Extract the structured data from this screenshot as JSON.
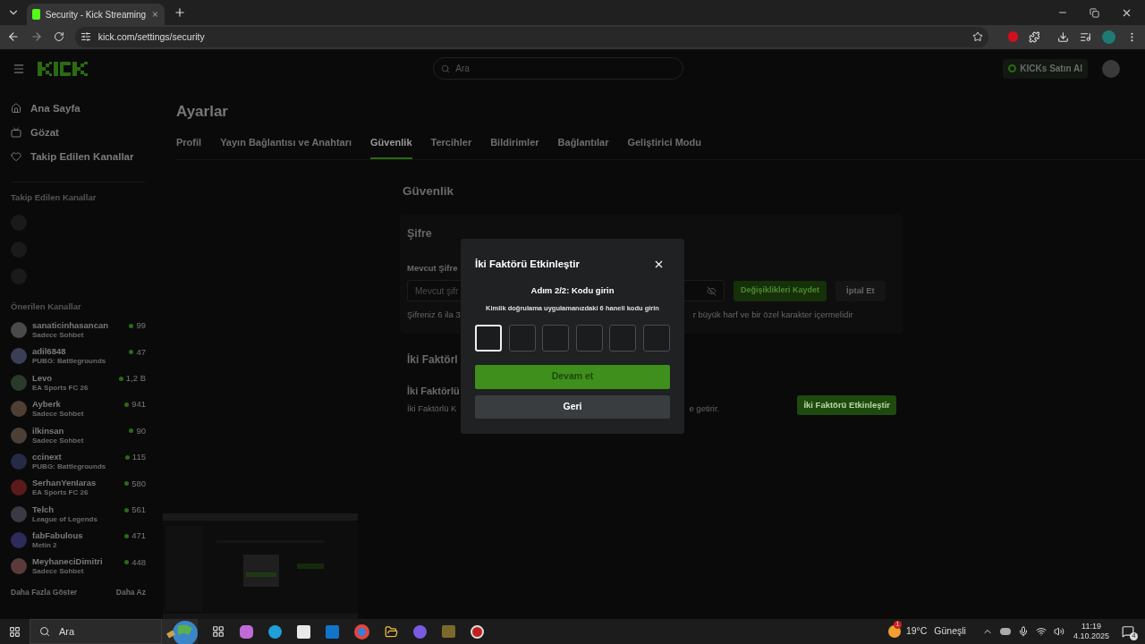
{
  "browser": {
    "tab_title": "Security - Kick Streaming",
    "url": "kick.com/settings/security"
  },
  "header": {
    "search": {
      "placeholder": "Ara"
    },
    "buy_button": "KICKs Satın Al"
  },
  "sidebar": {
    "nav": [
      "Ana Sayfa",
      "Gözat",
      "Takip Edilen Kanallar"
    ],
    "followed_heading": "Takip Edilen Kanallar",
    "recommended_heading": "Önerilen Kanallar",
    "recommended": [
      {
        "name": "sanaticinhasancan",
        "category": "Sadece Sohbet",
        "viewers": "99",
        "color": "#4a4a4a"
      },
      {
        "name": "adil6848",
        "category": "PUBG: Battlegrounds",
        "viewers": "47",
        "color": "#3a3f55"
      },
      {
        "name": "Levo",
        "category": "EA Sports FC 26",
        "viewers": "1,2 B",
        "color": "#2a3a2a"
      },
      {
        "name": "Ayberk",
        "category": "Sadece Sohbet",
        "viewers": "941",
        "color": "#4f3f33"
      },
      {
        "name": "ilkinsan",
        "category": "Sadece Sohbet",
        "viewers": "90",
        "color": "#4a4038"
      },
      {
        "name": "ccinext",
        "category": "PUBG: Battlegrounds",
        "viewers": "115",
        "color": "#252a45"
      },
      {
        "name": "SerhanYenIaras",
        "category": "EA Sports FC 26",
        "viewers": "580",
        "color": "#5a1a1a"
      },
      {
        "name": "Telch",
        "category": "League of Legends",
        "viewers": "561",
        "color": "#3a3a44"
      },
      {
        "name": "fabFabulous",
        "category": "Metin 2",
        "viewers": "471",
        "color": "#2e2a5a"
      },
      {
        "name": "MeyhaneciDimitri",
        "category": "Sadece Sohbet",
        "viewers": "448",
        "color": "#5a3a3a"
      }
    ],
    "show_more": "Daha Fazla Göster",
    "show_less": "Daha Az"
  },
  "page": {
    "title": "Ayarlar",
    "tabs": [
      {
        "label": "Profil",
        "selected": false
      },
      {
        "label": "Yayın Bağlantısı ve Anahtarı",
        "selected": false
      },
      {
        "label": "Güvenlik",
        "selected": true
      },
      {
        "label": "Tercihler",
        "selected": false
      },
      {
        "label": "Bildirimler",
        "selected": false
      },
      {
        "label": "Bağlantılar",
        "selected": false
      },
      {
        "label": "Geliştirici Modu",
        "selected": false
      }
    ],
    "section_title": "Güvenlik",
    "password": {
      "title": "Şifre",
      "label": "Mevcut Şifre",
      "placeholder": "Mevcut şifr",
      "save": "Değişiklikleri Kaydet",
      "cancel": "İptal Et",
      "hint_left": "Şifreniz 6 ila 3",
      "hint_right": "r büyük harf ve bir özel karakter içermelidir"
    },
    "two_factor": {
      "heading": "İki Faktörl",
      "title": "İki Faktörlü",
      "desc_left": "İki Faktörlü K",
      "desc_right": "e getirir.",
      "button": "İki Faktörü Etkinleştir"
    }
  },
  "modal": {
    "title": "İki Faktörü Etkinleştir",
    "step": "Adım 2/2: Kodu girin",
    "instruction": "Kimlik doğrulama uygulamanızdaki 6 haneli kodu girin",
    "code_boxes": [
      {
        "selected": true
      },
      {
        "selected": false
      },
      {
        "selected": false
      },
      {
        "selected": false
      },
      {
        "selected": false
      },
      {
        "selected": false
      }
    ],
    "continue": "Devam et",
    "back": "Geri"
  },
  "taskbar": {
    "search": "Ara",
    "temperature": "19°C",
    "weather": "Güneşli",
    "time": "11:19",
    "date": "4.10.2025",
    "notifications": "4",
    "weather_badge": "1"
  }
}
